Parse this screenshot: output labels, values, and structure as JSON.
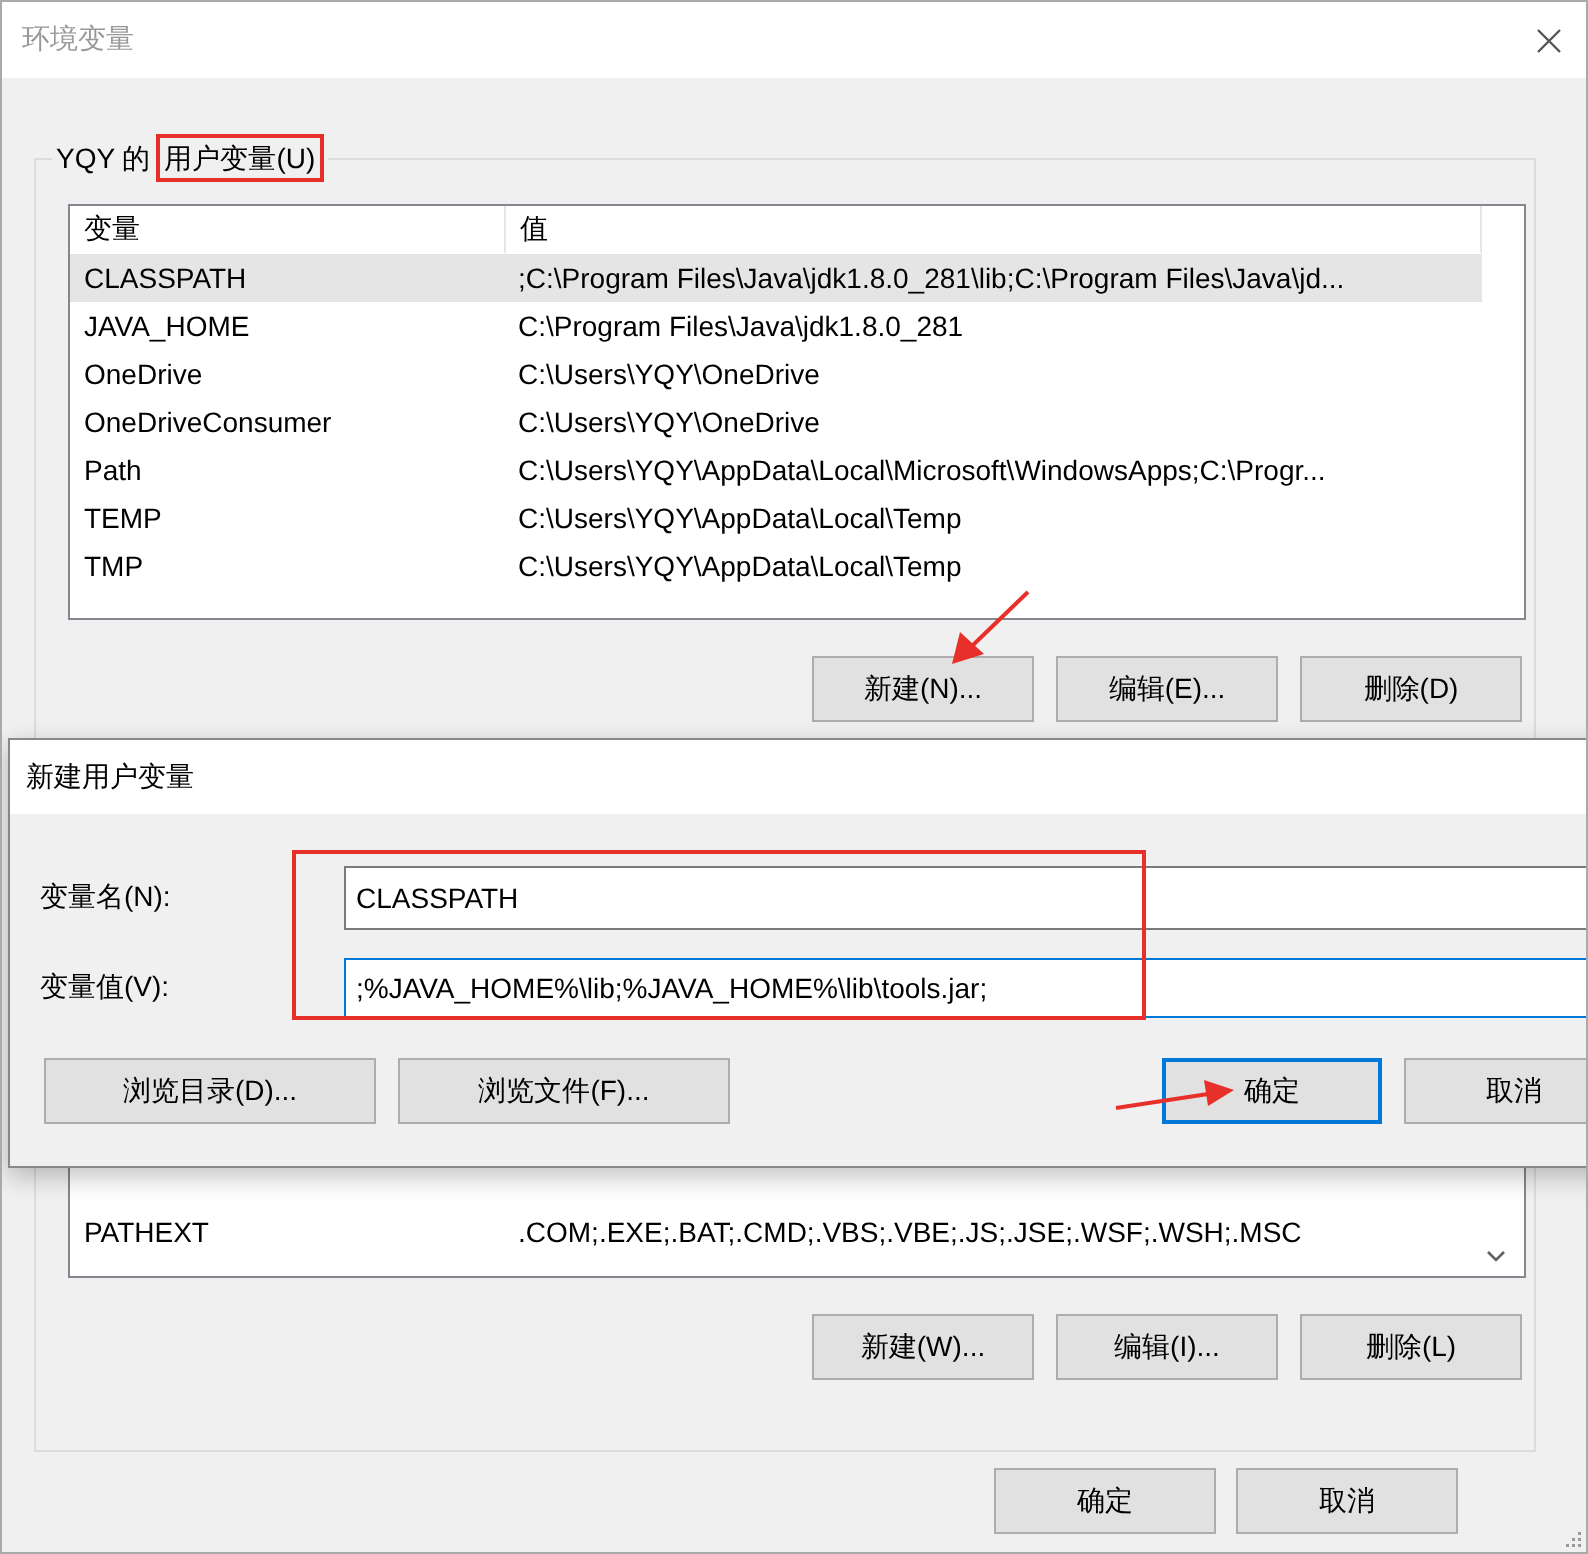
{
  "window": {
    "title": "环境变量"
  },
  "user_variables": {
    "owner": "YQY 的",
    "label": "用户变量(U)",
    "columns": [
      "变量",
      "值"
    ],
    "rows": [
      {
        "name": "CLASSPATH",
        "value": ";C:\\Program Files\\Java\\jdk1.8.0_281\\lib;C:\\Program Files\\Java\\jd...",
        "selected": true
      },
      {
        "name": "JAVA_HOME",
        "value": "C:\\Program Files\\Java\\jdk1.8.0_281",
        "selected": false
      },
      {
        "name": "OneDrive",
        "value": "C:\\Users\\YQY\\OneDrive",
        "selected": false
      },
      {
        "name": "OneDriveConsumer",
        "value": "C:\\Users\\YQY\\OneDrive",
        "selected": false
      },
      {
        "name": "Path",
        "value": "C:\\Users\\YQY\\AppData\\Local\\Microsoft\\WindowsApps;C:\\Progr...",
        "selected": false
      },
      {
        "name": "TEMP",
        "value": "C:\\Users\\YQY\\AppData\\Local\\Temp",
        "selected": false
      },
      {
        "name": "TMP",
        "value": "C:\\Users\\YQY\\AppData\\Local\\Temp",
        "selected": false
      }
    ],
    "buttons": [
      "新建(N)...",
      "编辑(E)...",
      "删除(D)"
    ]
  },
  "system_variables": {
    "rows": [
      {
        "name": "PATHEXT",
        "value": ".COM;.EXE;.BAT;.CMD;.VBS;.VBE;.JS;.JSE;.WSF;.WSH;.MSC",
        "selected": false
      }
    ],
    "buttons": [
      "新建(W)...",
      "编辑(I)...",
      "删除(L)"
    ]
  },
  "footer_buttons": [
    "确定",
    "取消"
  ],
  "dialog": {
    "title": "新建用户变量",
    "fields": [
      {
        "label": "变量名(N):",
        "value": "CLASSPATH",
        "focused": false
      },
      {
        "label": "变量值(V):",
        "value": ";%JAVA_HOME%\\lib;%JAVA_HOME%\\lib\\tools.jar;",
        "focused": true
      }
    ],
    "browse_buttons": [
      "浏览目录(D)...",
      "浏览文件(F)..."
    ],
    "buttons": [
      {
        "label": "确定",
        "default": true
      },
      {
        "label": "取消",
        "default": false
      }
    ]
  }
}
